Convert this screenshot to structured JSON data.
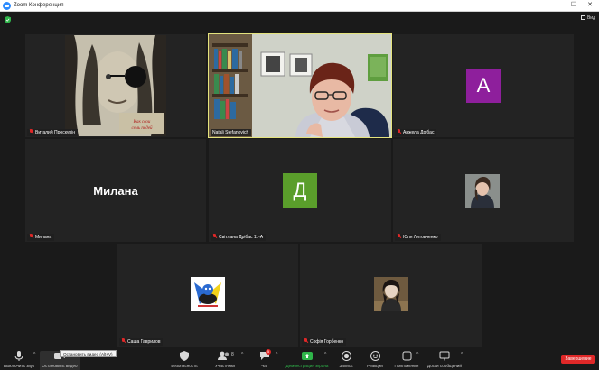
{
  "window": {
    "title": "Zoom Конференция",
    "controls": [
      "—",
      "☐",
      "✕"
    ]
  },
  "header": {
    "view_label": "Вид"
  },
  "participants": [
    {
      "name": "Виталий Проскурін",
      "kind": "image",
      "muted": true
    },
    {
      "name": "Natali Stefanovich",
      "kind": "video",
      "muted": false,
      "active": true
    },
    {
      "name": "Анжела Дрібас",
      "kind": "letter",
      "letter": "А",
      "color": "#8e1f9c",
      "muted": true
    },
    {
      "name": "Милана",
      "kind": "name",
      "big_name": "Милана",
      "muted": true
    },
    {
      "name": "Світлана Дрібас 11-А",
      "kind": "letter",
      "letter": "Д",
      "color": "#5a9e2b",
      "muted": true
    },
    {
      "name": "Юля Литовченко",
      "kind": "photo",
      "muted": true
    },
    {
      "name": "Саша Гаврилов",
      "kind": "photo",
      "muted": true
    },
    {
      "name": "Софія Горбенко",
      "kind": "photo",
      "muted": true
    }
  ],
  "toolbar": {
    "mute_label": "Выключить звук",
    "video_label": "Остановить видео",
    "video_tooltip": "Остановить видео (Alt+V)",
    "security_label": "Безопасность",
    "participants_label": "Участники",
    "participants_count": "8",
    "chat_label": "Чат",
    "chat_badge": "5",
    "share_label": "Демонстрация экрана",
    "record_label": "Запись",
    "reactions_label": "Реакции",
    "apps_label": "Приложения",
    "whiteboard_label": "Доски сообщений",
    "end_label": "Завершение"
  },
  "colors": {
    "background": "#1a1a1a",
    "tile": "#232323",
    "active_border": "#e4e37d",
    "share_green": "#2fb54a",
    "end_red": "#e02828",
    "mute_red": "#e02828"
  }
}
